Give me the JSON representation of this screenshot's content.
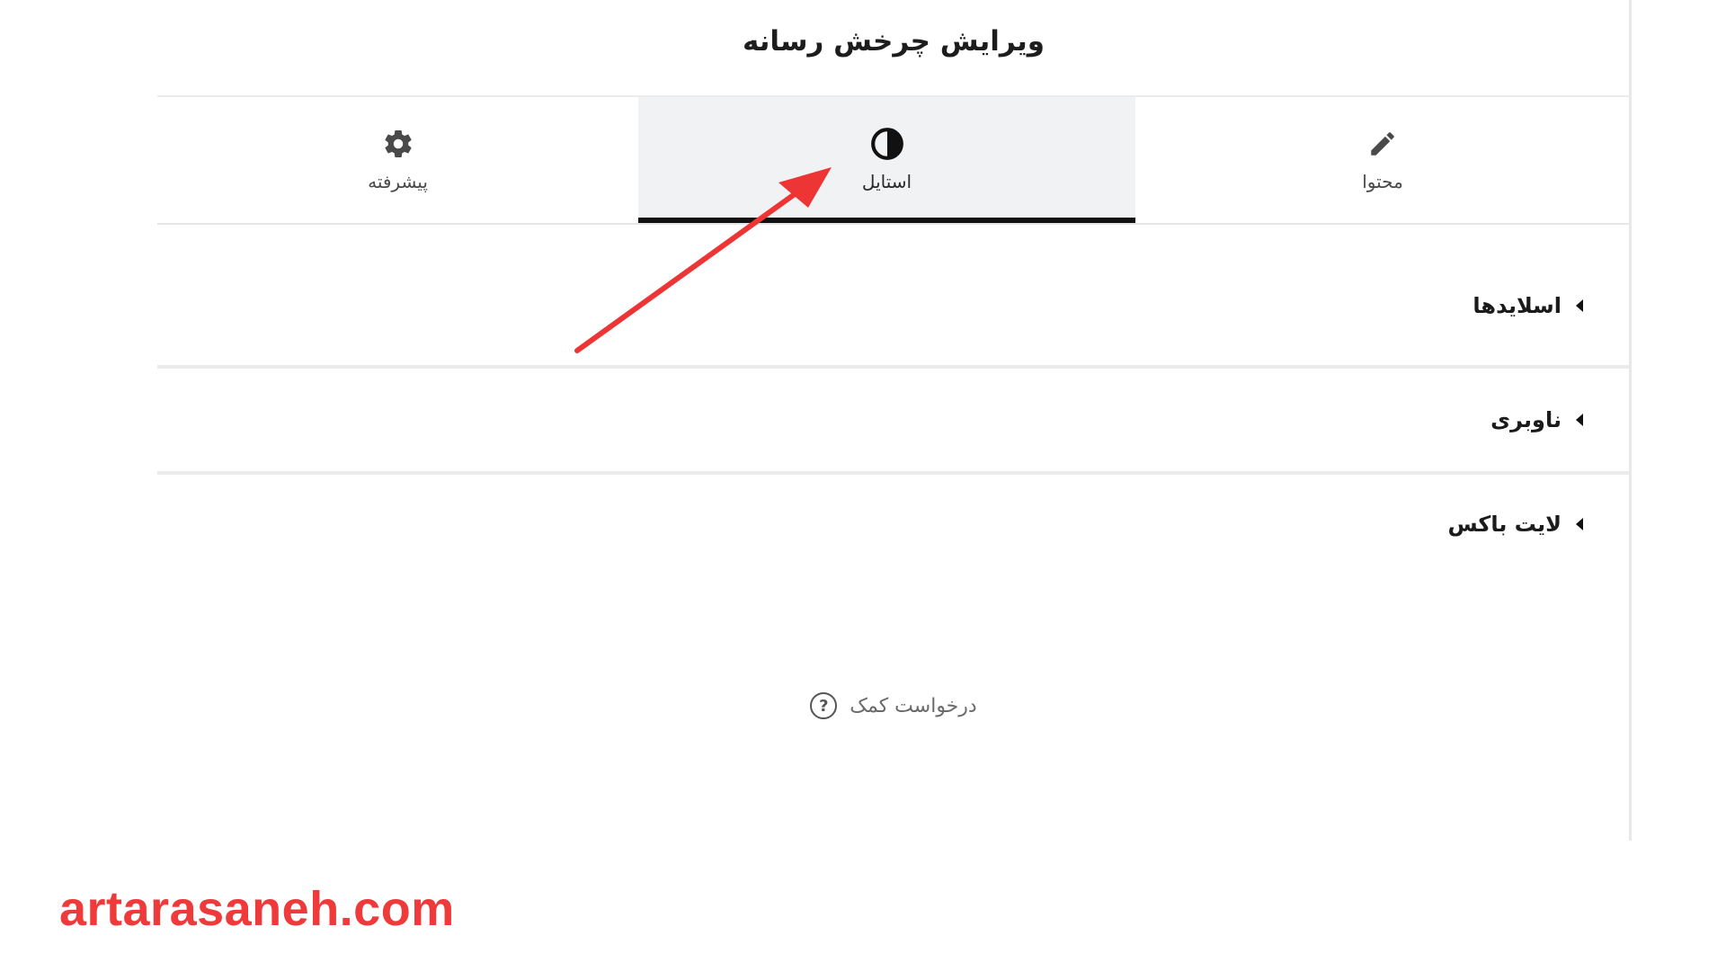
{
  "panel": {
    "title": "ویرایش چرخش رسانه"
  },
  "tabs": [
    {
      "label": "محتوا",
      "icon": "pencil-icon",
      "active": false
    },
    {
      "label": "استایل",
      "icon": "contrast-icon",
      "active": true
    },
    {
      "label": "پیشرفته",
      "icon": "gear-icon",
      "active": false
    }
  ],
  "sections": [
    {
      "title": "اسلایدها"
    },
    {
      "title": "ناوبری"
    },
    {
      "title": "لایت باکس"
    }
  ],
  "help": {
    "label": "درخواست کمک",
    "icon": "question-icon"
  },
  "watermark": {
    "text": "artarasaneh.com",
    "color": "#ee3a3a"
  },
  "colors": {
    "arrow": "#ee3535",
    "active_tab_bg": "#f1f2f3",
    "active_tab_border": "#111111"
  }
}
